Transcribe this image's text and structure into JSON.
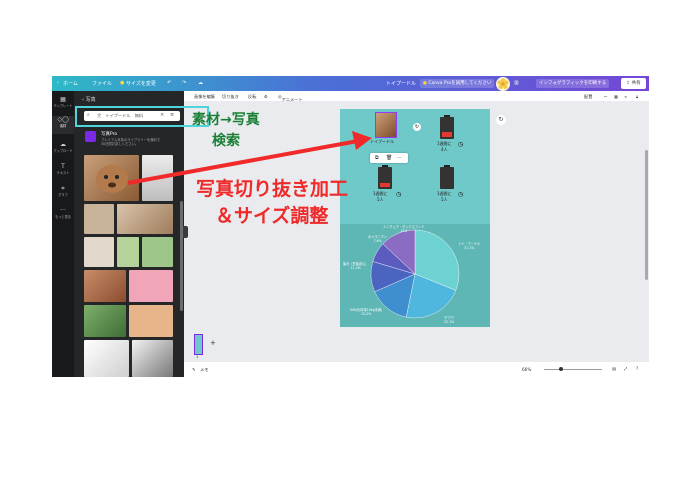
{
  "topbar": {
    "home": "ホーム",
    "file": "ファイル",
    "resize": "サイズを変更",
    "doc_title": "トイプードル",
    "pro_trial": "Canva Proを試用してください",
    "infographic": "インフォグラフィックを印刷する",
    "share": "共有"
  },
  "rail": {
    "items": [
      {
        "label": "テンプレート",
        "icon": "layout-icon"
      },
      {
        "label": "素材",
        "icon": "elements-icon"
      },
      {
        "label": "アップロード",
        "icon": "upload-icon"
      },
      {
        "label": "テキスト",
        "icon": "text-icon"
      },
      {
        "label": "グラフ",
        "icon": "chart-icon"
      },
      {
        "label": "もっと見る",
        "icon": "more-icon"
      }
    ]
  },
  "panel": {
    "back": "写真",
    "search_value": "犬　トイプードル　無料",
    "promo_title": "写真Pro",
    "promo_desc": "プレミアム写真のライブラリーを無料で\n30日間お試しください。"
  },
  "toolbar": {
    "edit_image": "画像を編集",
    "crop": "切り抜き",
    "flip": "反転",
    "animate": "アニメート",
    "position": "配置"
  },
  "canvas": {
    "dog_label": "トイプードル",
    "batteries": [
      {
        "label": "1週間に\n4人"
      },
      {
        "label": "1週間に\n5人"
      },
      {
        "label": "1週間に\n5人"
      }
    ],
    "pie_labels": [
      {
        "text": "ミニチュア・ダックスフンド\n13%"
      },
      {
        "text": "ポメラニアン\n7.4%"
      },
      {
        "text": "トイ・プードル\n31.1%"
      },
      {
        "text": "柴犬（豆柴含む）\n11.2%"
      },
      {
        "text": "MIX犬(体重10kg未満)\n15.2%"
      },
      {
        "text": "チワワ\n22.1%"
      }
    ]
  },
  "chart_data": {
    "type": "pie",
    "categories": [
      "トイ・プードル",
      "チワワ",
      "MIX犬(体重10kg未満)",
      "柴犬（豆柴含む）",
      "ポメラニアン",
      "ミニチュア・ダックスフンド"
    ],
    "values": [
      31.1,
      22.1,
      15.2,
      11.2,
      7.4,
      13
    ],
    "colors": [
      "#6fd2d2",
      "#4fb6dd",
      "#3f8fd0",
      "#4a64bf",
      "#5c5bc0",
      "#8a6cc2"
    ]
  },
  "footer": {
    "notes": "メモ",
    "zoom": "66%",
    "zoom_level": 0.3,
    "page": "1"
  },
  "annotations": {
    "material": "素材→写真",
    "search": "検索",
    "crop_line1": "写真切り抜き加工",
    "crop_line2": "＆サイズ調整"
  },
  "colors": {
    "accent": "#7d2ae8",
    "annotation_red": "#f02a2a",
    "annotation_green": "#1b7f36",
    "annotation_box": "#4fd4dc"
  }
}
